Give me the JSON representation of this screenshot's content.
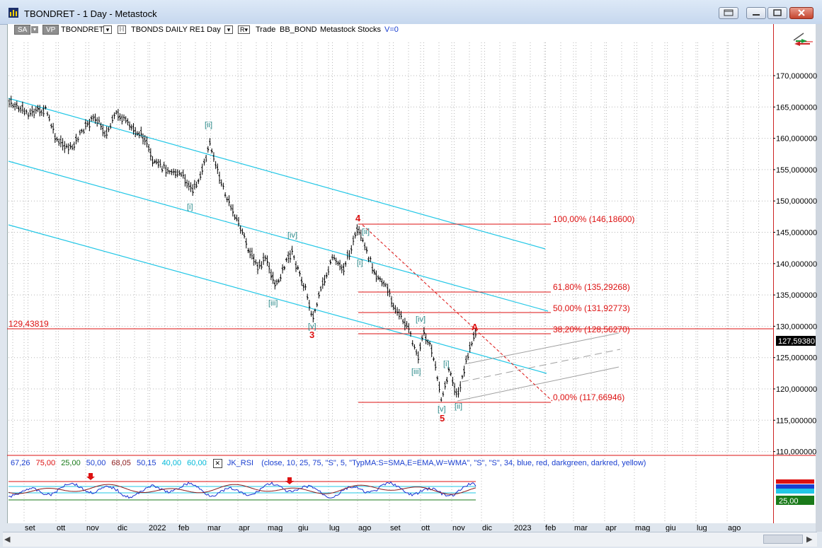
{
  "window": {
    "title": "TBONDRET - 1 Day - Metastock",
    "buttons": [
      "restore",
      "minimize",
      "maximize",
      "close"
    ]
  },
  "toolbar": {
    "sa_label": "SA",
    "vp_label": "VP",
    "symbol": "TBONDRET",
    "dropdown_glyph": "▾",
    "bracket_glyph": "|·|",
    "security_name": "TBONDS DAILY RE",
    "period": "1 Day",
    "r_label": "R▾",
    "trade_label": "Trade",
    "text1": "BB_BOND",
    "text2": "Metastock",
    "text3": "Stocks",
    "v_label": "V=0"
  },
  "price_axis": {
    "labels": [
      "170,000000",
      "165,000000",
      "160,000000",
      "155,000000",
      "150,000000",
      "145,000000",
      "140,000000",
      "135,000000",
      "130,000000",
      "125,000000",
      "120,000000",
      "115,000000",
      "110,000000"
    ],
    "current_price": "127,59380"
  },
  "chart": {
    "hline_label": "129,43819",
    "fib_labels": [
      "100,00% (146,18600)",
      "61,80% (135,29268)",
      "50,00% (131,92773)",
      "38,20% (128,56270)",
      "0,00% (117,66946)"
    ],
    "wave_labels_teal": [
      "[ii]",
      "[i]",
      "[iv]",
      "[iii]",
      "[v]",
      "[ii]",
      "[i]",
      "[iv]",
      "[iii]",
      "[i]",
      "[v]",
      "[ii]"
    ],
    "wave_labels_red": [
      "4",
      "3",
      "5",
      "A"
    ],
    "colors": {
      "price_bars": "#000000",
      "channel": "#00c8e6",
      "fib": "#dd1111",
      "wave_teal": "#2a8a8a",
      "wave_red": "#dd1111",
      "gray_channel": "#999999"
    }
  },
  "indicator": {
    "values": [
      {
        "text": "67,26",
        "color": "#1a3fd0"
      },
      {
        "text": "75,00",
        "color": "#dd1111"
      },
      {
        "text": "25,00",
        "color": "#1a7a1a"
      },
      {
        "text": "50,00",
        "color": "#1a3fd0"
      },
      {
        "text": "68,05",
        "color": "#8b1a1a"
      },
      {
        "text": "50,15",
        "color": "#1a3fd0"
      },
      {
        "text": "40,00",
        "color": "#00b8d8"
      },
      {
        "text": "60,00",
        "color": "#00b8d8"
      }
    ],
    "close_glyph": "✕",
    "name": "JK_RSI",
    "params": "(close,  10,  25,  75,  \"S\",  5,  \"TypMA:S=SMA,E=EMA,W=WMA\",  \"S\",  \"S\",  34,  blue,  red,  darkgreen,  darkred,  yellow)",
    "axis_label": "25,00"
  },
  "time_axis": {
    "labels": [
      "set",
      "ott",
      "nov",
      "dic",
      "2022",
      "feb",
      "mar",
      "apr",
      "mag",
      "giu",
      "lug",
      "ago",
      "set",
      "ott",
      "nov",
      "dic",
      "2023",
      "feb",
      "mar",
      "apr",
      "mag",
      "giu",
      "lug",
      "ago"
    ]
  },
  "scrollbar": {
    "left_arrow": "◀",
    "right_arrow": "▶"
  }
}
